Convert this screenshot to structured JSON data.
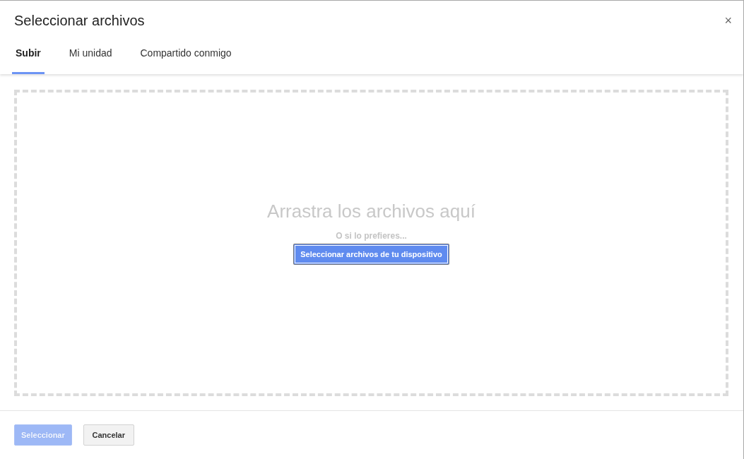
{
  "dialog": {
    "title": "Seleccionar archivos",
    "close": "×"
  },
  "tabs": [
    {
      "label": "Subir",
      "selected": true
    },
    {
      "label": "Mi unidad",
      "selected": false
    },
    {
      "label": "Compartido conmigo",
      "selected": false
    }
  ],
  "dropzone": {
    "heading": "Arrastra los archivos aquí",
    "hint": "O si lo prefieres...",
    "button": "Seleccionar archivos de tu dispositivo"
  },
  "footer": {
    "buttons": [
      {
        "label": "Seleccionar",
        "kind": "primary",
        "disabled": true
      },
      {
        "label": "Cancelar",
        "kind": "secondary",
        "disabled": false
      }
    ]
  }
}
